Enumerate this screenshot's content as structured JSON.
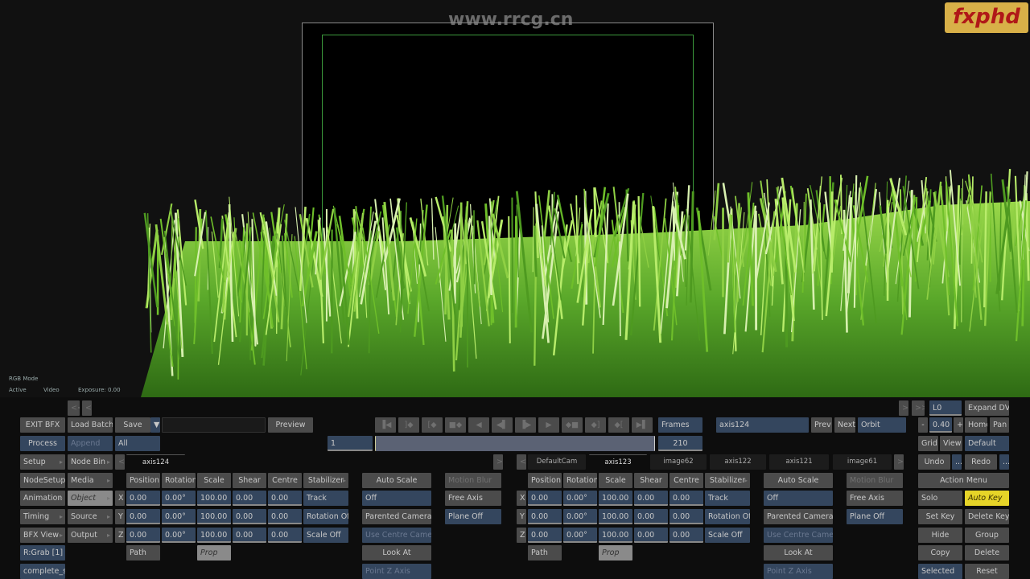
{
  "watermark": "www.rrcg.cn",
  "logo": "fxphd",
  "viewer": {
    "mode_label": "RGB Mode",
    "state": "Active",
    "source": "Video",
    "exposure": "Exposure: 0.00"
  },
  "colors": {
    "button": "#4b4b4b",
    "button_active": "#34465e",
    "auto_key": "#e6d428",
    "safe_frame": "#3c9a3c",
    "grass": "#6fbf2a"
  },
  "left_menu": [
    "EXIT BFX",
    "Process",
    "Setup",
    "NodeSetup",
    "Animation",
    "Timing",
    "BFX View",
    "R:Grab [1]",
    "complete_sc"
  ],
  "second_menu": [
    "Load Batch",
    "Append",
    "Node Bin",
    "Media",
    "Object",
    "Source",
    "Output"
  ],
  "nav": {
    "first": "<<",
    "prev": "<",
    "next": ">",
    "last": ">>"
  },
  "batch": {
    "save": "Save",
    "save_dropdown": "▼",
    "name_value": "",
    "preview": "Preview",
    "all": "All"
  },
  "transport": {
    "icons": [
      "goto-start",
      "prev-key",
      "prev-mark",
      "step-back-key",
      "play-reverse",
      "step-back",
      "step-forward",
      "play",
      "step-forward-key",
      "next-mark",
      "next-key",
      "goto-end"
    ],
    "glyphs": [
      "▐◀",
      "]◆",
      "[◆",
      "■◆",
      "◀",
      "◀▌",
      "▐▶",
      "▶",
      "◆■",
      "◆]",
      "◆[",
      "▶▌"
    ],
    "frames": "Frames",
    "current_frame": "1",
    "end_frame": "210"
  },
  "axis_left": {
    "tab": "axis124",
    "headers": [
      "Position",
      "Rotation",
      "Scale",
      "Shear",
      "Centre",
      "Stabilizer"
    ],
    "axes": [
      "X",
      "Y",
      "Z"
    ],
    "rows": [
      [
        "0.00",
        "0.00°",
        "100.00",
        "0.00",
        "0.00"
      ],
      [
        "0.00",
        "0.00°",
        "100.00",
        "0.00",
        "0.00"
      ],
      [
        "0.00",
        "0.00°",
        "100.00",
        "0.00",
        "0.00"
      ]
    ],
    "stab": [
      "Track",
      "Rotation Off",
      "Scale Off"
    ],
    "path": "Path",
    "prop": "Prop"
  },
  "cam_left": {
    "auto_scale": "Auto Scale",
    "off": "Off",
    "parented": "Parented Camera",
    "use_centre": "Use Centre Camera",
    "look_at": "Look At",
    "point_z": "Point Z Axis",
    "motion_blur": "Motion Blur",
    "free_axis": "Free Axis",
    "plane_off": "Plane Off"
  },
  "node_tabs": [
    "DefaultCam",
    "axis123",
    "image62",
    "axis122",
    "axis121",
    "image61"
  ],
  "axis_right": {
    "headers": [
      "Position",
      "Rotation",
      "Scale",
      "Shear",
      "Centre",
      "Stabilizer"
    ],
    "axes": [
      "X",
      "Y",
      "Z"
    ],
    "rows": [
      [
        "0.00",
        "0.00°",
        "100.00",
        "0.00",
        "0.00"
      ],
      [
        "0.00",
        "0.00°",
        "100.00",
        "0.00",
        "0.00"
      ],
      [
        "0.00",
        "0.00°",
        "100.00",
        "0.00",
        "0.00"
      ]
    ],
    "stab": [
      "Track",
      "Rotation Off",
      "Scale Off"
    ],
    "path": "Path",
    "prop": "Prop"
  },
  "cam_right": {
    "auto_scale": "Auto Scale",
    "off": "Off",
    "parented": "Parented Camera",
    "use_centre": "Use Centre Camera",
    "look_at": "Look At",
    "point_z": "Point Z Axis",
    "motion_blur": "Motion Blur",
    "free_axis": "Free Axis",
    "plane_off": "Plane Off"
  },
  "node_select": {
    "value": "axis124",
    "prev": "Prev",
    "next": "Next",
    "orbit": "Orbit"
  },
  "view": {
    "layer": "L0",
    "expand": "Expand DVE",
    "minus": "-",
    "zoom": "0.40",
    "plus": "+",
    "home": "Home",
    "pan": "Pan",
    "grid": "Grid",
    "view": "View",
    "default": "Default",
    "undo": "Undo",
    "undo_more": "...",
    "redo": "Redo",
    "redo_more": "..."
  },
  "action": {
    "menu": "Action Menu",
    "solo": "Solo",
    "auto_key": "Auto Key",
    "set_key": "Set Key",
    "delete_key": "Delete Key",
    "hide": "Hide",
    "group": "Group",
    "copy": "Copy",
    "delete": "Delete",
    "selected": "Selected",
    "reset": "Reset"
  }
}
